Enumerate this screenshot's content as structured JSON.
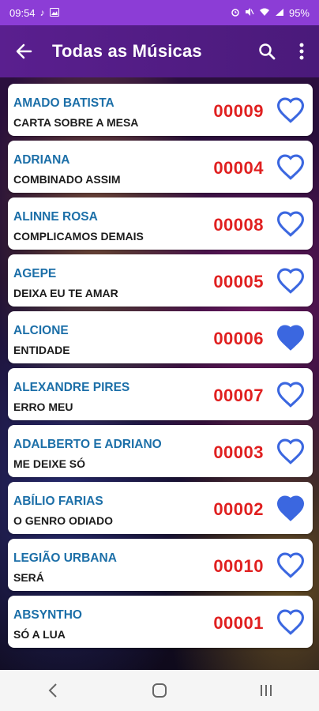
{
  "status": {
    "time": "09:54",
    "battery": "95%"
  },
  "header": {
    "title": "Todas as Músicas"
  },
  "colors": {
    "accent": "#8c3dd6",
    "artist": "#1c6fa8",
    "code": "#e02020",
    "heart": "#3b67e0"
  },
  "songs": [
    {
      "artist": "AMADO BATISTA",
      "title": "CARTA SOBRE A MESA",
      "code": "00009",
      "favorite": false
    },
    {
      "artist": "ADRIANA",
      "title": "COMBINADO ASSIM",
      "code": "00004",
      "favorite": false
    },
    {
      "artist": "ALINNE ROSA",
      "title": "COMPLICAMOS DEMAIS",
      "code": "00008",
      "favorite": false
    },
    {
      "artist": "AGEPE",
      "title": "DEIXA EU TE AMAR",
      "code": "00005",
      "favorite": false
    },
    {
      "artist": "ALCIONE",
      "title": "ENTIDADE",
      "code": "00006",
      "favorite": true
    },
    {
      "artist": "ALEXANDRE PIRES",
      "title": "ERRO MEU",
      "code": "00007",
      "favorite": false
    },
    {
      "artist": "ADALBERTO E ADRIANO",
      "title": "ME DEIXE SÓ",
      "code": "00003",
      "favorite": false
    },
    {
      "artist": "ABÍLIO FARIAS",
      "title": "O GENRO ODIADO",
      "code": "00002",
      "favorite": true
    },
    {
      "artist": "LEGIÃO URBANA",
      "title": "SERÁ",
      "code": "00010",
      "favorite": false
    },
    {
      "artist": "ABSYNTHO",
      "title": "SÓ A LUA",
      "code": "00001",
      "favorite": false
    }
  ]
}
